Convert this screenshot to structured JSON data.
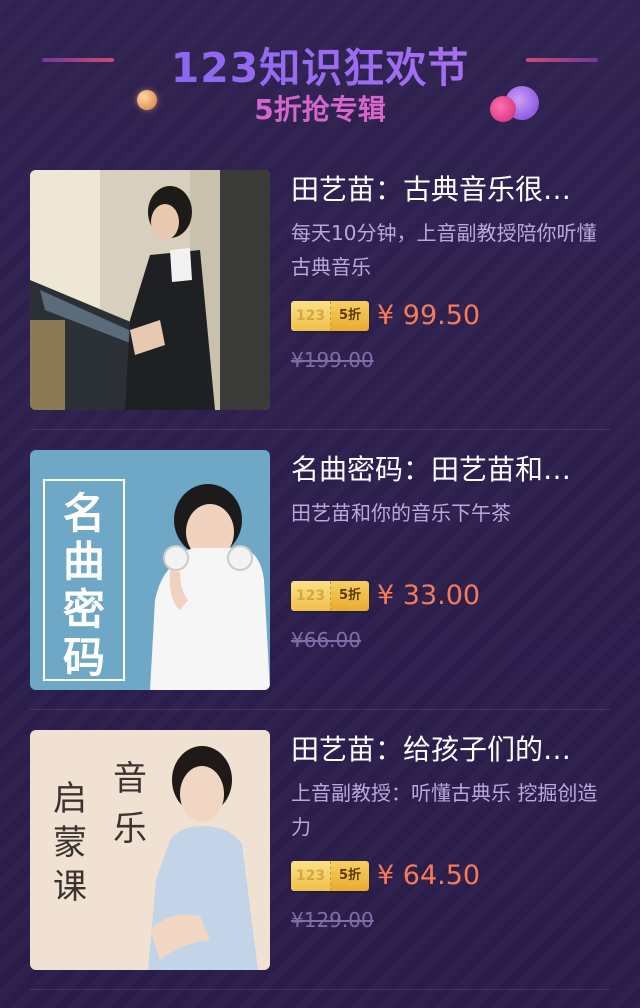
{
  "header": {
    "title": "123知识狂欢节",
    "subtitle": "5折抢专辑"
  },
  "colors": {
    "background": "#2e1f4f",
    "title_gradient": [
      "#7d62f0",
      "#b574f0"
    ],
    "subtitle": "#d467d8",
    "price": "#f57b58",
    "old_price": "#7e6ea7",
    "desc": "#b9a8de"
  },
  "products": [
    {
      "title": "田艺苗：古典音乐很…",
      "description": "每天10分钟，上音副教授陪你听懂古典音乐",
      "badge_left": "123",
      "badge_right": "5折",
      "price": "¥ 99.50",
      "original_price": "¥199.00"
    },
    {
      "title": "名曲密码：田艺苗和…",
      "description": "田艺苗和你的音乐下午茶",
      "badge_left": "123",
      "badge_right": "5折",
      "price": "¥ 33.00",
      "original_price": "¥66.00",
      "cover_text": [
        "名",
        "曲",
        "密",
        "码"
      ]
    },
    {
      "title": "田艺苗：给孩子们的…",
      "description": "上音副教授：听懂古典乐 挖掘创造力",
      "badge_left": "123",
      "badge_right": "5折",
      "price": "¥ 64.50",
      "original_price": "¥129.00",
      "cover_text": [
        "启",
        "蒙",
        "课",
        "音",
        "乐"
      ]
    }
  ]
}
